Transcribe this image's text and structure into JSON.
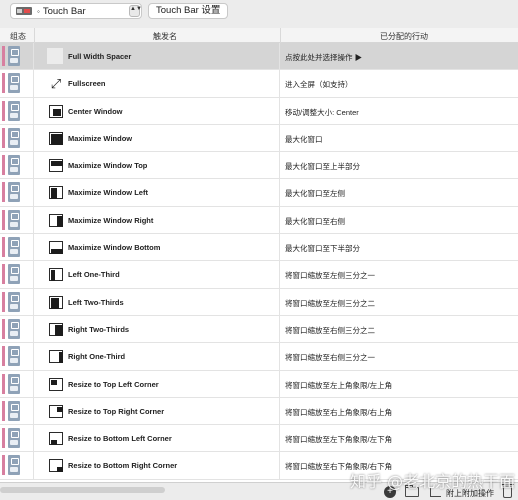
{
  "toolbar": {
    "selector_dot": "◦",
    "selector_label": "Touch Bar",
    "selector_arrows": "▲▼",
    "settings_button": "Touch Bar 设置"
  },
  "table": {
    "headers": {
      "group": "组态",
      "trigger": "触发名",
      "action": "已分配的行动"
    },
    "rows": [
      {
        "icon": "blank-icon",
        "name": "Full Width Spacer",
        "action": "点按此处并选择操作 ▶",
        "selected": true
      },
      {
        "icon": "expand-arrows-icon",
        "name": "Fullscreen",
        "action": "进入全屏（如支持）"
      },
      {
        "icon": "window-center-icon",
        "name": "Center Window",
        "action": "移动/调整大小: Center"
      },
      {
        "icon": "window-maximize-icon",
        "name": "Maximize Window",
        "action": "最大化窗口"
      },
      {
        "icon": "window-top-half-icon",
        "name": "Maximize Window Top",
        "action": "最大化窗口至上半部分"
      },
      {
        "icon": "window-left-half-icon",
        "name": "Maximize Window Left",
        "action": "最大化窗口至左侧"
      },
      {
        "icon": "window-right-half-icon",
        "name": "Maximize Window Right",
        "action": "最大化窗口至右侧"
      },
      {
        "icon": "window-bottom-half-icon",
        "name": "Maximize Window Bottom",
        "action": "最大化窗口至下半部分"
      },
      {
        "icon": "window-left-third-icon",
        "name": "Left One-Third",
        "action": "将窗口缩放至左侧三分之一"
      },
      {
        "icon": "window-left-two-thirds-icon",
        "name": "Left Two-Thirds",
        "action": "将窗口缩放至左侧三分之二"
      },
      {
        "icon": "window-right-two-thirds-icon",
        "name": "Right Two-Thirds",
        "action": "将窗口缩放至右侧三分之二"
      },
      {
        "icon": "window-right-third-icon",
        "name": "Right One-Third",
        "action": "将窗口缩放至右侧三分之一"
      },
      {
        "icon": "window-top-left-corner-icon",
        "name": "Resize to Top Left Corner",
        "action": "将窗口缩放至左上角象限/左上角"
      },
      {
        "icon": "window-top-right-corner-icon",
        "name": "Resize to Top Right Corner",
        "action": "将窗口缩放至右上角象限/右上角"
      },
      {
        "icon": "window-bottom-left-corner-icon",
        "name": "Resize to Bottom Left Corner",
        "action": "将窗口缩放至左下角象限/左下角"
      },
      {
        "icon": "window-bottom-right-corner-icon",
        "name": "Resize to Bottom Right Corner",
        "action": "将窗口缩放至右下角象限/右下角"
      }
    ]
  },
  "bottom": {
    "add_symbol": "+",
    "attach_label": "附上附加操作"
  },
  "watermark": "知乎 @老北京的热干面",
  "colors": {
    "group_bar": "#d77fa0",
    "group_icon": "#8fa2b7",
    "selected_row": "#d5d5d5"
  }
}
